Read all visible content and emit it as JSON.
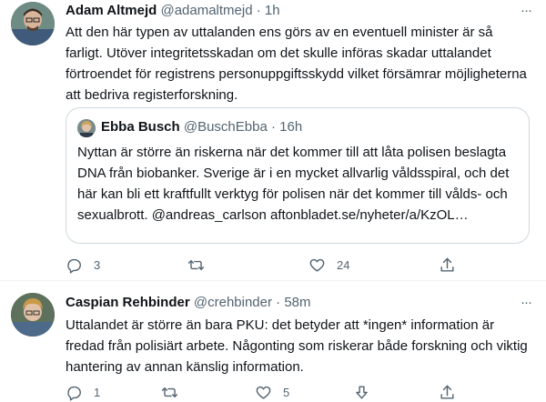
{
  "tweet1": {
    "author_name": "Adam Altmejd",
    "handle": "@adamaltmejd",
    "separator": "·",
    "time": "1h",
    "more": "···",
    "text": "Att den här typen av uttalanden ens görs av en eventuell minister är så farligt. Utöver integritetsskadan om det skulle införas skadar uttalandet förtroendet för registrens personuppgiftsskydd vilket försämrar möjligheterna att bedriva registerforskning.",
    "quote": {
      "author_name": "Ebba Busch",
      "handle": "@BuschEbba",
      "separator": "·",
      "time": "16h",
      "text": "Nyttan är större än riskerna när det kommer till att låta polisen beslagta DNA från biobanker. Sverige är i en mycket allvarlig våldsspiral, och det här kan bli ett kraftfullt verktyg för polisen när det kommer till vålds- och sexualbrott. @andreas_carlson aftonbladet.se/nyheter/a/KzOL…"
    },
    "actions": {
      "replies": "3",
      "retweets": "",
      "likes": "24"
    }
  },
  "tweet2": {
    "author_name": "Caspian Rehbinder",
    "handle": "@crehbinder",
    "separator": "·",
    "time": "58m",
    "more": "···",
    "text": "Uttalandet är större än bara PKU: det betyder att *ingen* information är fredad från polisiärt arbete. Någonting som riskerar både forskning och viktig hantering av annan känslig information.",
    "actions": {
      "replies": "1",
      "retweets": "",
      "likes": "5"
    }
  },
  "icons": {
    "reply": "reply-icon",
    "retweet": "retweet-icon",
    "like": "heart-icon",
    "share": "share-icon",
    "dislike": "downvote-arrow-icon",
    "more": "more-horizontal-icon"
  },
  "colors": {
    "text": "#0f1419",
    "secondary": "#536471",
    "border": "#cfd9de"
  }
}
